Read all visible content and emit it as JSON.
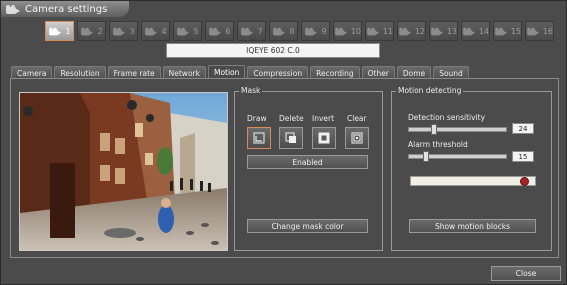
{
  "window": {
    "title": "Camera settings",
    "title_icon": "camera-icon"
  },
  "cameras": [
    {
      "label": "1",
      "active": true
    },
    {
      "label": "2"
    },
    {
      "label": "3"
    },
    {
      "label": "4"
    },
    {
      "label": "5"
    },
    {
      "label": "6"
    },
    {
      "label": "7"
    },
    {
      "label": "8"
    },
    {
      "label": "9"
    },
    {
      "label": "10"
    },
    {
      "label": "11"
    },
    {
      "label": "12"
    },
    {
      "label": "13"
    },
    {
      "label": "14"
    },
    {
      "label": "15"
    },
    {
      "label": "16"
    }
  ],
  "camera_model": "IQEYE 602 C.0",
  "tabs": [
    "Camera",
    "Resolution",
    "Frame rate",
    "Network",
    "Motion",
    "Compression",
    "Recording",
    "Other",
    "Dome",
    "Sound"
  ],
  "active_tab": "Motion",
  "mask": {
    "legend": "Mask",
    "tools": [
      {
        "label": "Draw",
        "icon": "draw-icon",
        "selected": true
      },
      {
        "label": "Delete",
        "icon": "delete-icon"
      },
      {
        "label": "Invert",
        "icon": "invert-icon"
      },
      {
        "label": "Clear",
        "icon": "clear-icon"
      }
    ],
    "enabled_label": "Enabled",
    "change_color_label": "Change mask color"
  },
  "motion": {
    "legend": "Motion detecting",
    "sensitivity_label": "Detection sensitivity",
    "sensitivity_value": "24",
    "sensitivity_fraction": 0.24,
    "alarm_label": "Alarm threshold",
    "alarm_value": "15",
    "alarm_fraction": 0.15,
    "show_blocks_label": "Show motion blocks",
    "indicator_color": "#a82424"
  },
  "close_label": "Close",
  "colors": {
    "background": "#4b4b4b",
    "accent": "#d88a5a",
    "alarm_led": "#a82424"
  }
}
